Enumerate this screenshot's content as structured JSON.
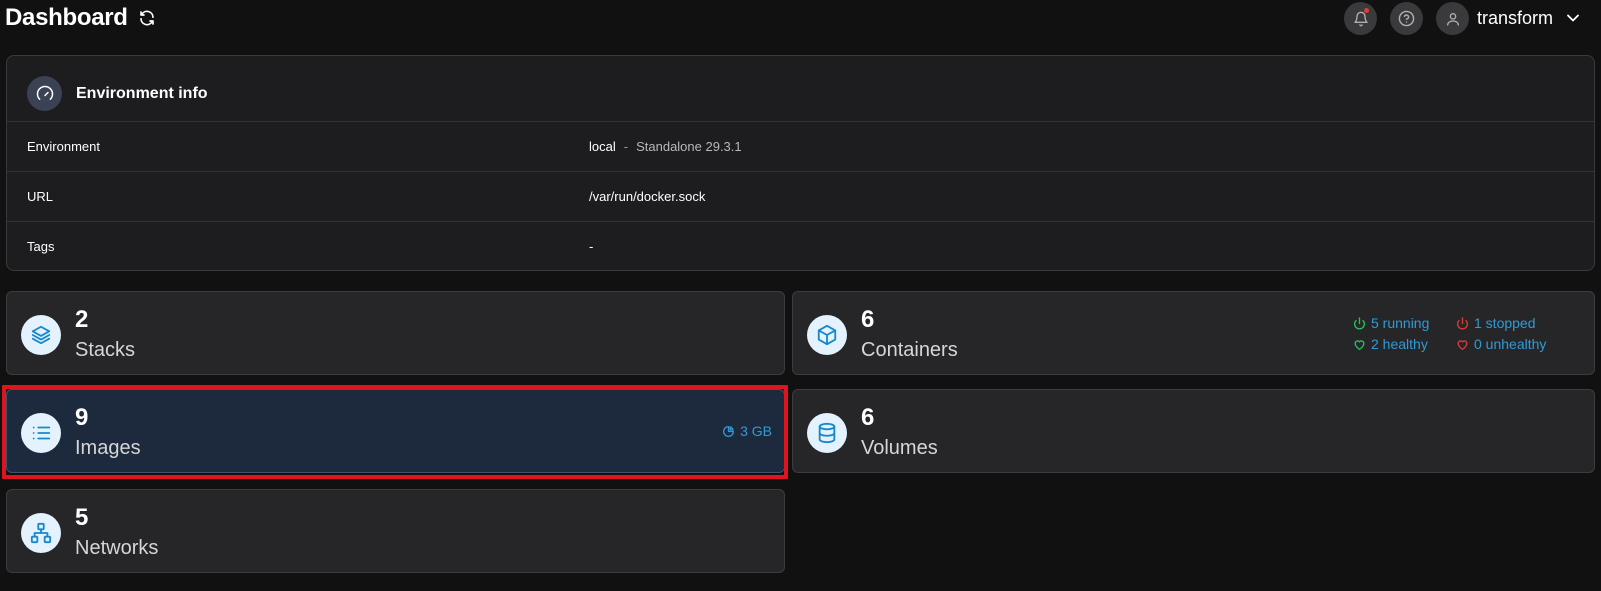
{
  "header": {
    "title": "Dashboard",
    "username": "transform"
  },
  "env_info": {
    "title": "Environment info",
    "rows": [
      {
        "label": "Environment",
        "value": "local",
        "separator": "-",
        "detail": "Standalone 29.3.1"
      },
      {
        "label": "URL",
        "value": "/var/run/docker.sock"
      },
      {
        "label": "Tags",
        "value": "-"
      }
    ]
  },
  "cards": {
    "stacks": {
      "count": "2",
      "label": "Stacks"
    },
    "containers": {
      "count": "6",
      "label": "Containers",
      "running": "5 running",
      "stopped": "1 stopped",
      "healthy": "2 healthy",
      "unhealthy": "0 unhealthy"
    },
    "images": {
      "count": "9",
      "label": "Images",
      "size": "3 GB"
    },
    "volumes": {
      "count": "6",
      "label": "Volumes"
    },
    "networks": {
      "count": "5",
      "label": "Networks"
    }
  },
  "colors": {
    "accent": "#2e9bd6",
    "running": "#22c55e",
    "stopped": "#e53935",
    "highlight": "#e0141e"
  }
}
